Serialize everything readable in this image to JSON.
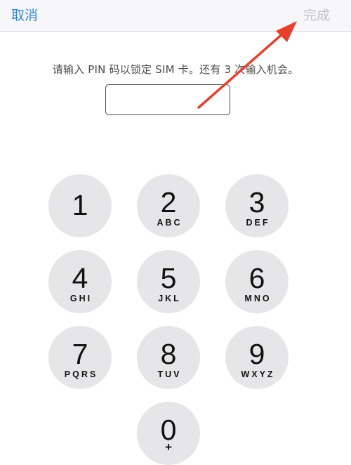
{
  "navbar": {
    "cancel_label": "取消",
    "done_label": "完成"
  },
  "prompt": {
    "text": "请输入 PIN 码以锁定 SIM 卡。还有 3 次输入机会。"
  },
  "pin_field": {
    "value": ""
  },
  "keypad": [
    {
      "digit": "1",
      "letters": ""
    },
    {
      "digit": "2",
      "letters": "ABC"
    },
    {
      "digit": "3",
      "letters": "DEF"
    },
    {
      "digit": "4",
      "letters": "GHI"
    },
    {
      "digit": "5",
      "letters": "JKL"
    },
    {
      "digit": "6",
      "letters": "MNO"
    },
    {
      "digit": "7",
      "letters": "PQRS"
    },
    {
      "digit": "8",
      "letters": "TUV"
    },
    {
      "digit": "9",
      "letters": "WXYZ"
    },
    {
      "digit": "0",
      "letters": "+"
    }
  ],
  "colors": {
    "accent": "#2e86e8",
    "disabled": "#c3c3c6",
    "key_background": "#e6e6e8",
    "annotation_arrow": "#e8402c"
  }
}
